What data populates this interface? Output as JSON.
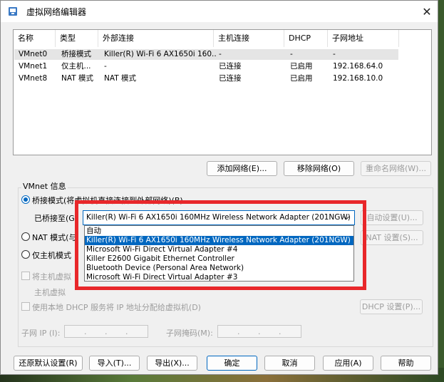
{
  "window": {
    "title": "虚拟网络编辑器",
    "close_glyph": "✕"
  },
  "table": {
    "columns": [
      "名称",
      "类型",
      "外部连接",
      "主机连接",
      "DHCP",
      "子网地址"
    ],
    "rows": [
      {
        "name": "VMnet0",
        "type": "桥接模式",
        "external": "Killer(R) Wi-Fi 6 AX1650i 160...",
        "host": "-",
        "dhcp": "-",
        "subnet": "-"
      },
      {
        "name": "VMnet1",
        "type": "仅主机...",
        "external": "-",
        "host": "已连接",
        "dhcp": "已启用",
        "subnet": "192.168.64.0"
      },
      {
        "name": "VMnet8",
        "type": "NAT 模式",
        "external": "NAT 模式",
        "host": "已连接",
        "dhcp": "已启用",
        "subnet": "192.168.10.0"
      }
    ]
  },
  "list_buttons": {
    "add": "添加网络(E)...",
    "remove": "移除网络(O)",
    "rename": "重命名网络(W)..."
  },
  "vmnet_info": {
    "label": "VMnet 信息",
    "bridge_mode": "桥接模式(将虚拟机直接连接到外部网络)(B)",
    "bridged_to_label": "已桥接至(G",
    "bridged_to_value": "Killer(R) Wi-Fi 6 AX1650i 160MHz Wireless Network Adapter (201NGW)",
    "auto_settings": "自动设置(U)...",
    "nat_mode": "NAT 模式(与",
    "nat_settings": "NAT 设置(S)...",
    "host_only": "仅主机模式",
    "connect_host_adapter": "将主机虚拟",
    "host_adapter_name": "主机虚拟",
    "use_dhcp": "使用本地 DHCP 服务将 IP 地址分配给虚拟机(D)",
    "dhcp_settings": "DHCP 设置(P)...",
    "subnet_ip_label": "子网 IP (I):",
    "subnet_mask_label": "子网掩码(M):"
  },
  "dropdown": {
    "options": [
      "自动",
      "Killer(R) Wi-Fi 6 AX1650i 160MHz Wireless Network Adapter (201NGW)",
      "Microsoft Wi-Fi Direct Virtual Adapter #4",
      "Killer E2600 Gigabit Ethernet Controller",
      "Bluetooth Device (Personal Area Network)",
      "Microsoft Wi-Fi Direct Virtual Adapter #3"
    ],
    "highlighted_index": 1
  },
  "footer_buttons": {
    "restore": "还原默认设置(R)",
    "import": "导入(T)...",
    "export": "导出(X)...",
    "ok": "确定",
    "cancel": "取消",
    "apply": "应用(A)",
    "help": "帮助"
  },
  "colors": {
    "accent": "#0067c0",
    "annotation": "#e8272a"
  }
}
